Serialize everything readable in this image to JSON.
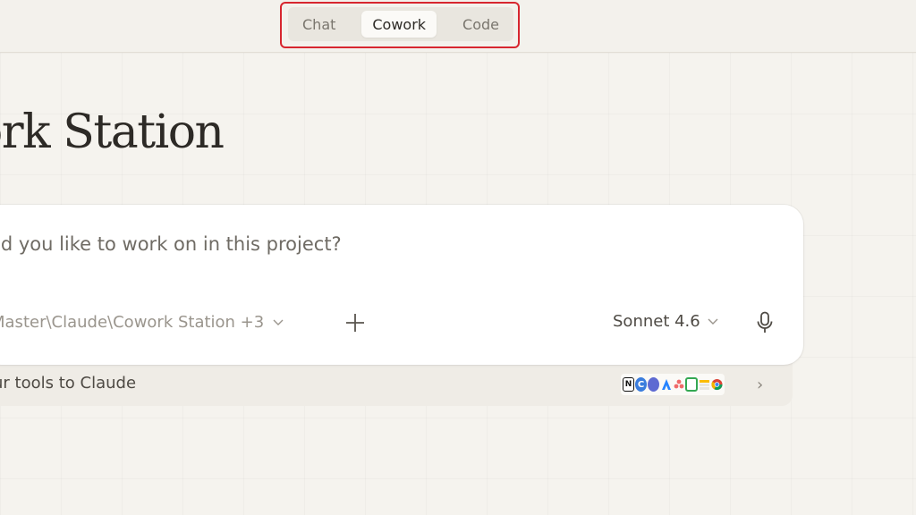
{
  "mode_tabs": [
    {
      "label": "Chat"
    },
    {
      "label": "Cowork"
    },
    {
      "label": "Code"
    }
  ],
  "active_tab": "Cowork",
  "highlight_color": "#d7262f",
  "project": {
    "title": "ork Station"
  },
  "composer": {
    "placeholder": "ld you like to work on in this project?",
    "folder_path": "Master\\Claude\\Cowork Station +3",
    "model": "Sonnet 4.6",
    "add_icon": "plus-icon",
    "mic_icon": "microphone-icon"
  },
  "tools": {
    "text": "ur tools to Claude",
    "icons": [
      "notion-icon",
      "canva-icon",
      "linear-icon",
      "atlassian-icon",
      "asana-icon",
      "google-calendar-icon",
      "drive-icon",
      "chrome-icon"
    ]
  }
}
